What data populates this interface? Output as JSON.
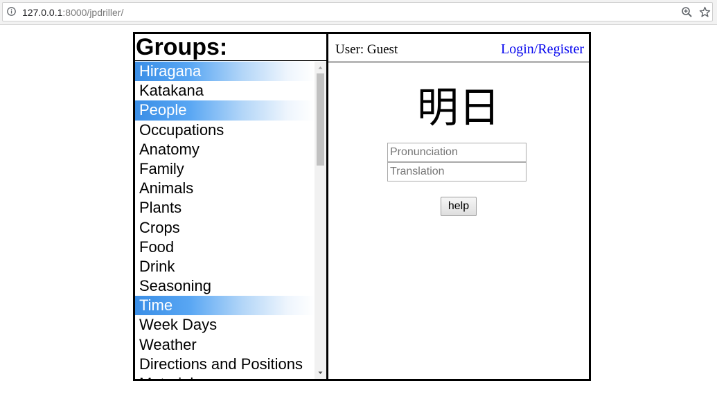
{
  "browser": {
    "url_host": "127.0.0.1",
    "url_rest": ":8000/jpdriller/"
  },
  "groups": {
    "title": "Groups:",
    "items": [
      {
        "label": "Hiragana",
        "active": true
      },
      {
        "label": "Katakana",
        "active": false
      },
      {
        "label": "People",
        "active": true
      },
      {
        "label": "Occupations",
        "active": false
      },
      {
        "label": "Anatomy",
        "active": false
      },
      {
        "label": "Family",
        "active": false
      },
      {
        "label": "Animals",
        "active": false
      },
      {
        "label": "Plants",
        "active": false
      },
      {
        "label": "Crops",
        "active": false
      },
      {
        "label": "Food",
        "active": false
      },
      {
        "label": "Drink",
        "active": false
      },
      {
        "label": "Seasoning",
        "active": false
      },
      {
        "label": "Time",
        "active": true
      },
      {
        "label": "Week Days",
        "active": false
      },
      {
        "label": "Weather",
        "active": false
      },
      {
        "label": "Directions and Positions",
        "active": false
      },
      {
        "label": "Materials",
        "active": false
      }
    ]
  },
  "header": {
    "user_label": "User: Guest",
    "login_link": "Login/Register"
  },
  "drill": {
    "kanji": "明日",
    "pronunciation_placeholder": "Pronunciation",
    "pronunciation_value": "",
    "translation_placeholder": "Translation",
    "translation_value": "",
    "help_label": "help"
  },
  "colors": {
    "active_item": "#3a8ee6",
    "link": "#0000ee"
  },
  "icons": [
    "info-icon",
    "zoom-icon",
    "star-icon",
    "scroll-up-arrow-icon",
    "scroll-down-arrow-icon"
  ]
}
